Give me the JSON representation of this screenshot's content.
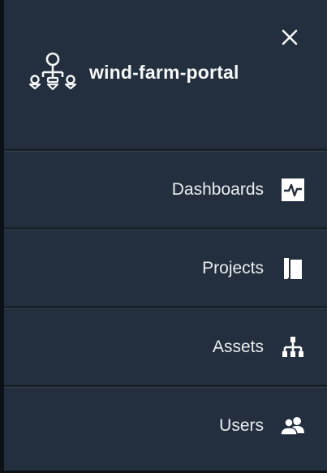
{
  "header": {
    "title": "wind-farm-portal",
    "logo_icon": "org-tree-logo-icon",
    "close_icon": "close-icon"
  },
  "nav": {
    "items": [
      {
        "label": "Dashboards",
        "icon": "activity-chart-icon"
      },
      {
        "label": "Projects",
        "icon": "folder-book-icon"
      },
      {
        "label": "Assets",
        "icon": "hierarchy-icon"
      },
      {
        "label": "Users",
        "icon": "users-icon"
      }
    ]
  },
  "colors": {
    "background": "#232f3e",
    "divider": "#19212b",
    "text": "#e9edf0",
    "icon": "#ffffff"
  }
}
